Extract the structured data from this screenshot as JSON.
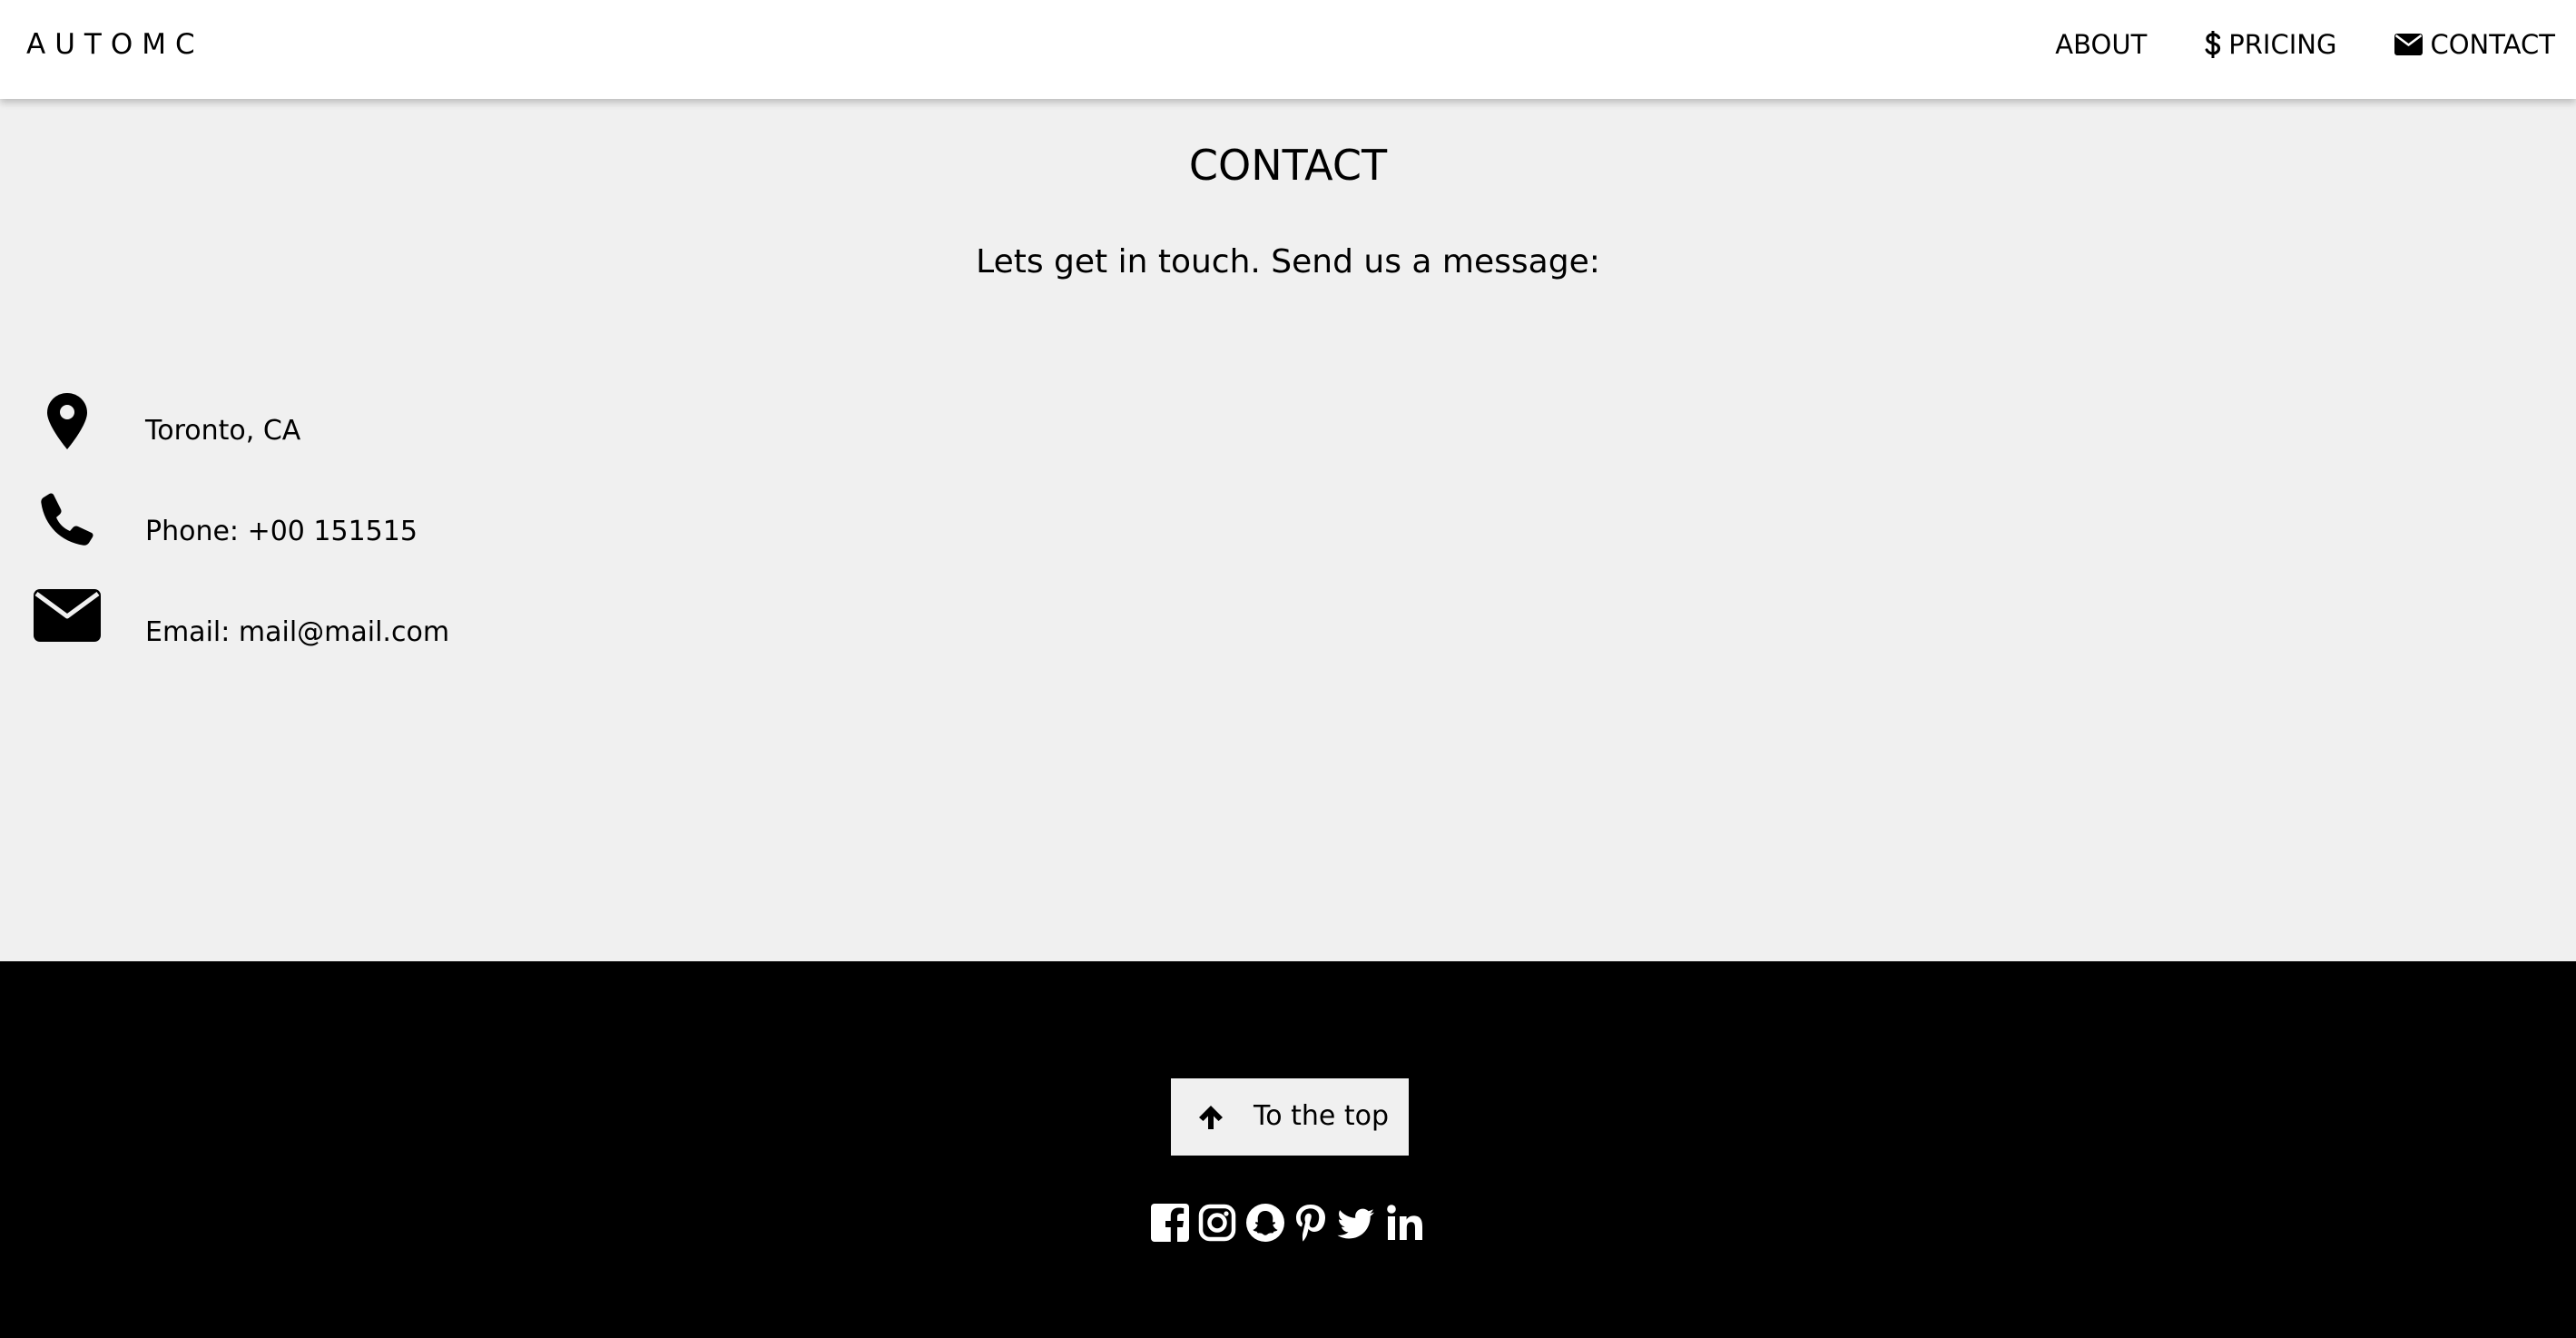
{
  "nav": {
    "brand": "AUTOMC",
    "items": [
      {
        "label": "ABOUT",
        "icon": null
      },
      {
        "label": "PRICING",
        "icon": "dollar-icon"
      },
      {
        "label": "CONTACT",
        "icon": "envelope-icon"
      }
    ]
  },
  "contact": {
    "title": "CONTACT",
    "subtitle": "Lets get in touch. Send us a message:",
    "info": [
      {
        "icon": "map-marker-icon",
        "text": "Toronto, CA"
      },
      {
        "icon": "phone-icon",
        "text": "Phone: +00 151515"
      },
      {
        "icon": "envelope-icon",
        "text": "Email: mail@mail.com"
      }
    ]
  },
  "footer": {
    "top_button_label": "To the top",
    "top_button_icon": "arrow-up-icon",
    "social_icons": [
      "facebook-icon",
      "instagram-icon",
      "snapchat-icon",
      "pinterest-icon",
      "twitter-icon",
      "linkedin-icon"
    ]
  },
  "colors": {
    "nav_background": "#ffffff",
    "page_background": "#f0f0f0",
    "footer_background": "#000000",
    "text": "#000000"
  }
}
